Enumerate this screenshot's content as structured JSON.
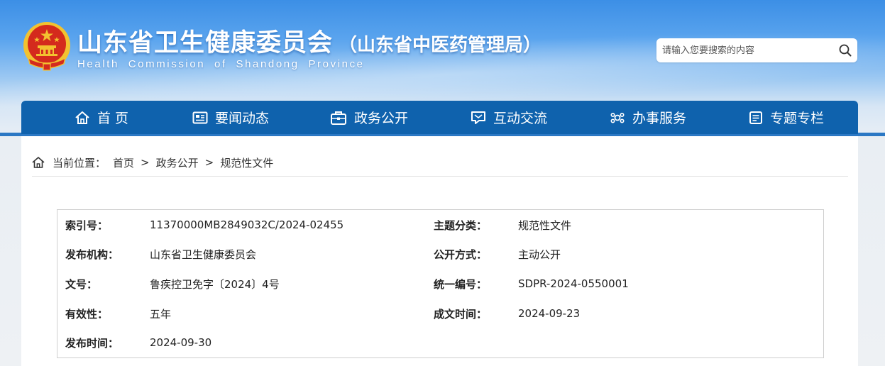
{
  "header": {
    "title": "山东省卫生健康委员会",
    "subtitle": "（山东省中医药管理局）",
    "english_name": "Health Commission of Shandong Province",
    "emblem_icon": "national-emblem-icon"
  },
  "search": {
    "placeholder": "请输入您要搜索的内容",
    "icon": "search-icon"
  },
  "nav": {
    "items": [
      {
        "label": "首 页",
        "icon": "home-icon"
      },
      {
        "label": "要闻动态",
        "icon": "news-icon"
      },
      {
        "label": "政务公开",
        "icon": "briefcase-icon"
      },
      {
        "label": "互动交流",
        "icon": "interaction-icon"
      },
      {
        "label": "办事服务",
        "icon": "service-icon"
      },
      {
        "label": "专题专栏",
        "icon": "column-icon"
      }
    ]
  },
  "breadcrumb": {
    "prefix": "当前位置：",
    "items": [
      "首页",
      "政务公开",
      "规范性文件"
    ],
    "separator": ">"
  },
  "info": {
    "rows": [
      {
        "label": "索引号：",
        "value": "11370000MB2849032C/2024-02455",
        "label2": "主题分类：",
        "value2": "规范性文件"
      },
      {
        "label": "发布机构：",
        "value": "山东省卫生健康委员会",
        "label2": "公开方式：",
        "value2": "主动公开"
      },
      {
        "label": "文号：",
        "value": "鲁疾控卫免字〔2024〕4号",
        "label2": "统一编号：",
        "value2": "SDPR-2024-0550001"
      },
      {
        "label": "有效性：",
        "value": "五年",
        "label2": "成文时间：",
        "value2": "2024-09-23"
      },
      {
        "label": "发布时间：",
        "value": "2024-09-30"
      }
    ]
  },
  "colors": {
    "nav_bg": "#0f62ad",
    "header_top": "#3c8fe6",
    "emblem_red": "#d42a1d",
    "emblem_gold": "#f2c230"
  }
}
